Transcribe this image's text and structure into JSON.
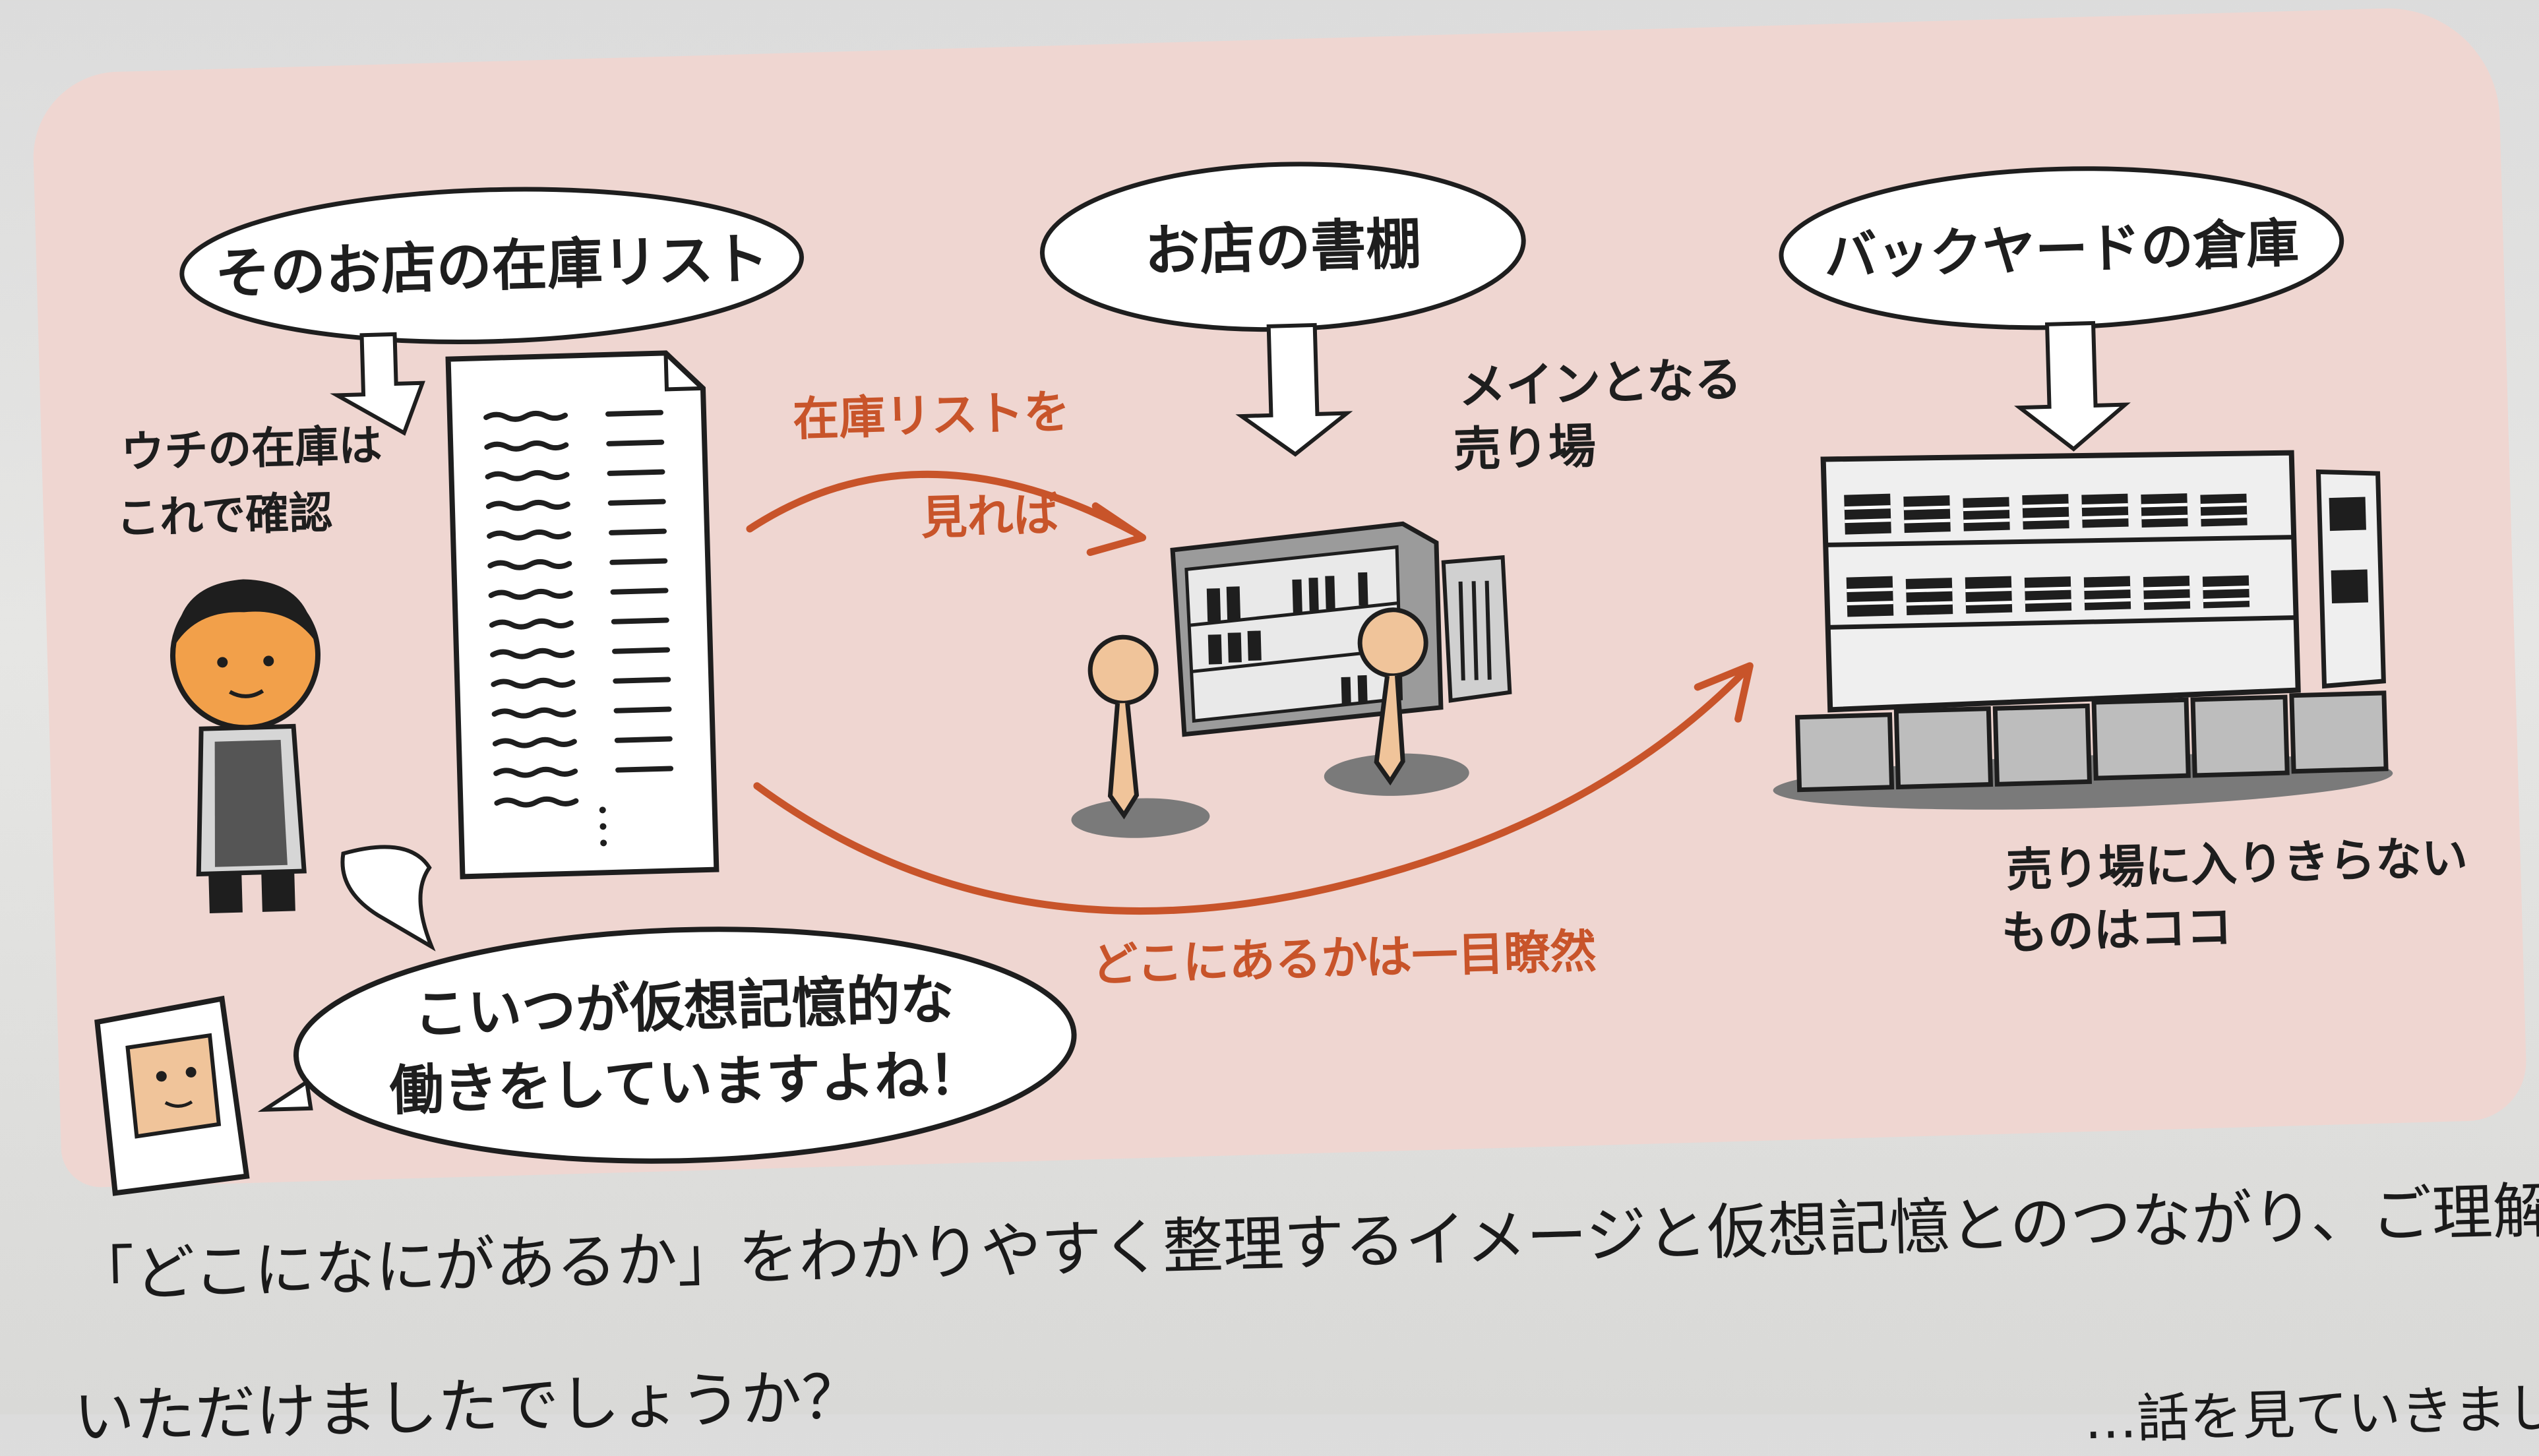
{
  "labels": {
    "stock_list": "そのお店の在庫リスト",
    "shop_shelf": "お店の書棚",
    "backyard_warehouse": "バックヤードの倉庫",
    "check_line1": "ウチの在庫は",
    "check_line2": "これで確認",
    "main_floor_line1": "メインとなる",
    "main_floor_line2": "売り場",
    "overflow_line1": "売り場に入りきらない",
    "overflow_line2": "ものはココ"
  },
  "arrows": {
    "top_line1": "在庫リストを",
    "top_line2": "見れば",
    "bottom": "どこにあるかは一目瞭然"
  },
  "speech": {
    "line1": "こいつが仮想記憶的な",
    "line2": "働きをしていますよね！"
  },
  "body": {
    "line1": "「どこになにがあるか」をわかりやすく整理するイメージと仮想記憶とのつながり、ご理解",
    "line2": "いただけましたでしょうか？",
    "line2_right": "…話を見ていきまし"
  },
  "colors": {
    "panel": "#efd6d1",
    "accent": "#c8542a",
    "ink": "#1e1e1e"
  }
}
